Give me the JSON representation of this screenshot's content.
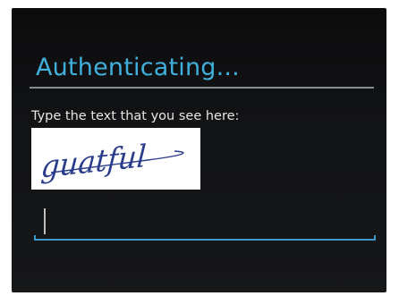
{
  "dialog": {
    "title": "Authenticating...",
    "prompt": "Type the text that you see here:",
    "captcha": {
      "text": "guatful"
    },
    "input": {
      "value": ""
    }
  },
  "colors": {
    "background": "#121315",
    "title": "#3fb0dc",
    "divider": "#8a8d90",
    "accent": "#3a9ad0",
    "captcha_ink": "#2a3c8c"
  }
}
